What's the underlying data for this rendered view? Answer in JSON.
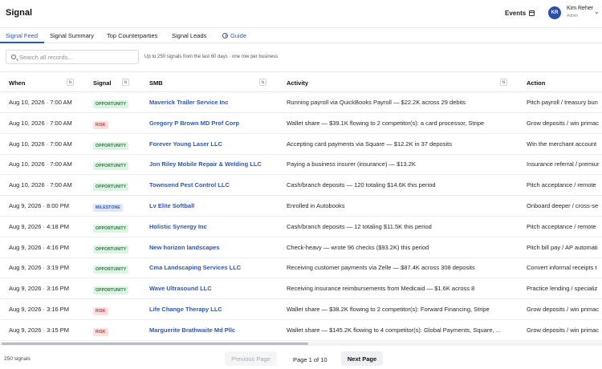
{
  "app": {
    "title": "Signal"
  },
  "header": {
    "events_label": "Events",
    "user": {
      "initials": "KR",
      "name": "Kim Reher",
      "role": "Admin"
    }
  },
  "tabs": [
    {
      "label": "Signal Feed",
      "active": true
    },
    {
      "label": "Signal Summary",
      "active": false
    },
    {
      "label": "Top Counterparties",
      "active": false
    },
    {
      "label": "Signal Leads",
      "active": false
    },
    {
      "label": "Guide",
      "active": false
    }
  ],
  "search": {
    "placeholder": "Search all records...",
    "value": ""
  },
  "hint": "Up to 250 signals from the last 60 days · one row per business",
  "table": {
    "columns": [
      "When",
      "Signal",
      "SMB",
      "Activity",
      "Action"
    ],
    "rows": [
      {
        "when": "Aug 10, 2026 · 7:00 AM",
        "signal": "OPPORTUNITY",
        "type": "opportunity",
        "smb": "Maverick Trailer Service Inc",
        "activity": "Running payroll via QuickBooks Payroll — $22.2K across 29 debits",
        "action": "Pitch payroll / treasury bun"
      },
      {
        "when": "Aug 10, 2026 · 7:00 AM",
        "signal": "RISK",
        "type": "risk",
        "smb": "Gregory P Brown MD Prof Corp",
        "activity": "Wallet share — $39.1K flowing to 2 competitor(s): a card processor, Stripe",
        "action": "Grow deposits / win primac"
      },
      {
        "when": "Aug 10, 2026 · 7:00 AM",
        "signal": "OPPORTUNITY",
        "type": "opportunity",
        "smb": "Forever Young Laser LLC",
        "activity": "Accepting card payments via Square — $12.2K in 37 deposits",
        "action": "Win the merchant account"
      },
      {
        "when": "Aug 10, 2026 · 7:00 AM",
        "signal": "OPPORTUNITY",
        "type": "opportunity",
        "smb": "Jon Riley Mobile Repair & Welding LLC",
        "activity": "Paying a business insurer (insurance) — $13.2K",
        "action": "Insurance referral / premiur"
      },
      {
        "when": "Aug 10, 2026 · 7:00 AM",
        "signal": "OPPORTUNITY",
        "type": "opportunity",
        "smb": "Townsend Pest Control LLC",
        "activity": "Cash/branch deposits — 120 totaling $14.6K this period",
        "action": "Pitch acceptance / remote"
      },
      {
        "when": "Aug 9, 2026 · 8:00 PM",
        "signal": "MILESTONE",
        "type": "milestone",
        "smb": "Lv Elite Softball",
        "activity": "Enrolled in Autobooks",
        "action": "Onboard deeper / cross-se"
      },
      {
        "when": "Aug 9, 2026 · 4:18 PM",
        "signal": "OPPORTUNITY",
        "type": "opportunity",
        "smb": "Holistic Synergy Inc",
        "activity": "Cash/branch deposits — 12 totaling $11.5K this period",
        "action": "Pitch acceptance / remote"
      },
      {
        "when": "Aug 9, 2026 · 4:16 PM",
        "signal": "OPPORTUNITY",
        "type": "opportunity",
        "smb": "New horizon landscapes",
        "activity": "Check-heavy — wrote 96 checks ($93.2K) this period",
        "action": "Pitch bill pay / AP automati"
      },
      {
        "when": "Aug 9, 2026 · 3:19 PM",
        "signal": "OPPORTUNITY",
        "type": "opportunity",
        "smb": "Cma Landscaping Services LLC",
        "activity": "Receiving customer payments via Zelle — $87.4K across 308 deposits",
        "action": "Convert informal receipts t"
      },
      {
        "when": "Aug 9, 2026 · 3:16 PM",
        "signal": "OPPORTUNITY",
        "type": "opportunity",
        "smb": "Wave Ultrasound LLC",
        "activity": "Receiving insurance reimbursements from Medicaid — $1.6K across 8",
        "action": "Practice lending / specializ"
      },
      {
        "when": "Aug 9, 2026 · 3:16 PM",
        "signal": "RISK",
        "type": "risk",
        "smb": "Life Change Therapy LLC",
        "activity": "Wallet share — $38.2K flowing to 2 competitor(s): Forward Financing, Stripe",
        "action": "Grow deposits / win primac"
      },
      {
        "when": "Aug 9, 2026 · 3:15 PM",
        "signal": "RISK",
        "type": "risk",
        "smb": "Marguerite Brathwaite Md Pllc",
        "activity": "Wallet share — $145.2K flowing to 4 competitor(s): Global Payments, Square, ...",
        "action": "Grow deposits / win primac"
      }
    ]
  },
  "footer": {
    "count": "250 signals",
    "prev_label": "Previous Page",
    "page_indicator": "Page 1 of 10",
    "next_label": "Next Page"
  },
  "colors": {
    "accent": "#2b57b8",
    "opportunity": "#1d7a3a",
    "risk": "#c03a3a",
    "milestone": "#2b57b8"
  },
  "icons": [
    "calendar-icon",
    "chevron-down-icon",
    "clock-icon",
    "search-icon",
    "sort-icon"
  ]
}
